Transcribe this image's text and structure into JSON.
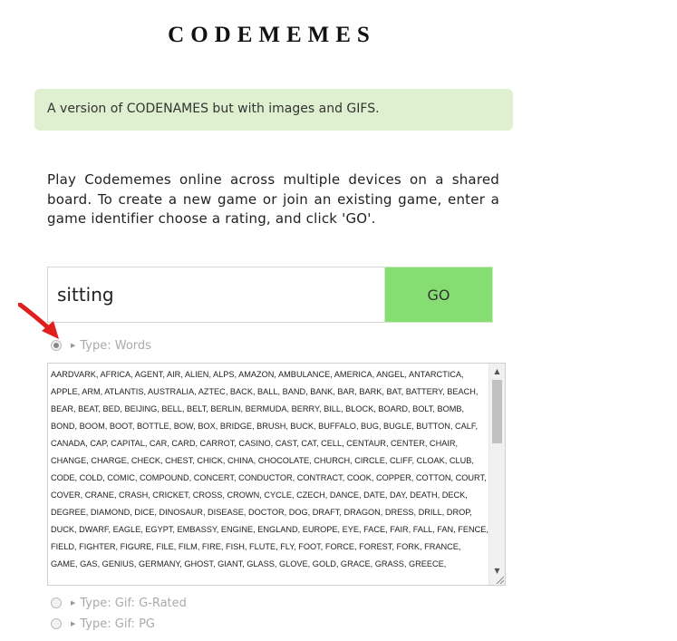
{
  "app": {
    "title": "CODEMEMES",
    "notice": "A version of CODENAMES but with images and GIFS.",
    "intro": "Play Codememes online across multiple devices on a shared board. To create a new game or join an existing game, enter a game identifier choose a rating, and click 'GO'."
  },
  "form": {
    "game_id_value": "sitting",
    "go_label": "GO"
  },
  "types": [
    {
      "label": "Type: Words",
      "selected": true
    },
    {
      "label": "Type: Gif: G-Rated",
      "selected": false
    },
    {
      "label": "Type: Gif: PG",
      "selected": false
    }
  ],
  "word_list": "AARDVARK, AFRICA, AGENT, AIR, ALIEN, ALPS, AMAZON, AMBULANCE, AMERICA, ANGEL, ANTARCTICA, APPLE, ARM, ATLANTIS, AUSTRALIA, AZTEC, BACK, BALL, BAND, BANK, BAR, BARK, BAT, BATTERY, BEACH, BEAR, BEAT, BED, BEIJING, BELL, BELT, BERLIN, BERMUDA, BERRY, BILL, BLOCK, BOARD, BOLT, BOMB, BOND, BOOM, BOOT, BOTTLE, BOW, BOX, BRIDGE, BRUSH, BUCK, BUFFALO, BUG, BUGLE, BUTTON, CALF, CANADA, CAP, CAPITAL, CAR, CARD, CARROT, CASINO, CAST, CAT, CELL, CENTAUR, CENTER, CHAIR, CHANGE, CHARGE, CHECK, CHEST, CHICK, CHINA, CHOCOLATE, CHURCH, CIRCLE, CLIFF, CLOAK, CLUB, CODE, COLD, COMIC, COMPOUND, CONCERT, CONDUCTOR, CONTRACT, COOK, COPPER, COTTON, COURT, COVER, CRANE, CRASH, CRICKET, CROSS, CROWN, CYCLE, CZECH, DANCE, DATE, DAY, DEATH, DECK, DEGREE, DIAMOND, DICE, DINOSAUR, DISEASE, DOCTOR, DOG, DRAFT, DRAGON, DRESS, DRILL, DROP, DUCK, DWARF, EAGLE, EGYPT, EMBASSY, ENGINE, ENGLAND, EUROPE, EYE, FACE, FAIR, FALL, FAN, FENCE, FIELD, FIGHTER, FIGURE, FILE, FILM, FIRE, FISH, FLUTE, FLY, FOOT, FORCE, FOREST, FORK, FRANCE, GAME, GAS, GENIUS, GERMANY, GHOST, GIANT, GLASS, GLOVE, GOLD, GRACE, GRASS, GREECE,",
  "colors": {
    "notice_bg": "#dff0d0",
    "go_bg": "#86de72",
    "arrow": "#e0201c"
  }
}
